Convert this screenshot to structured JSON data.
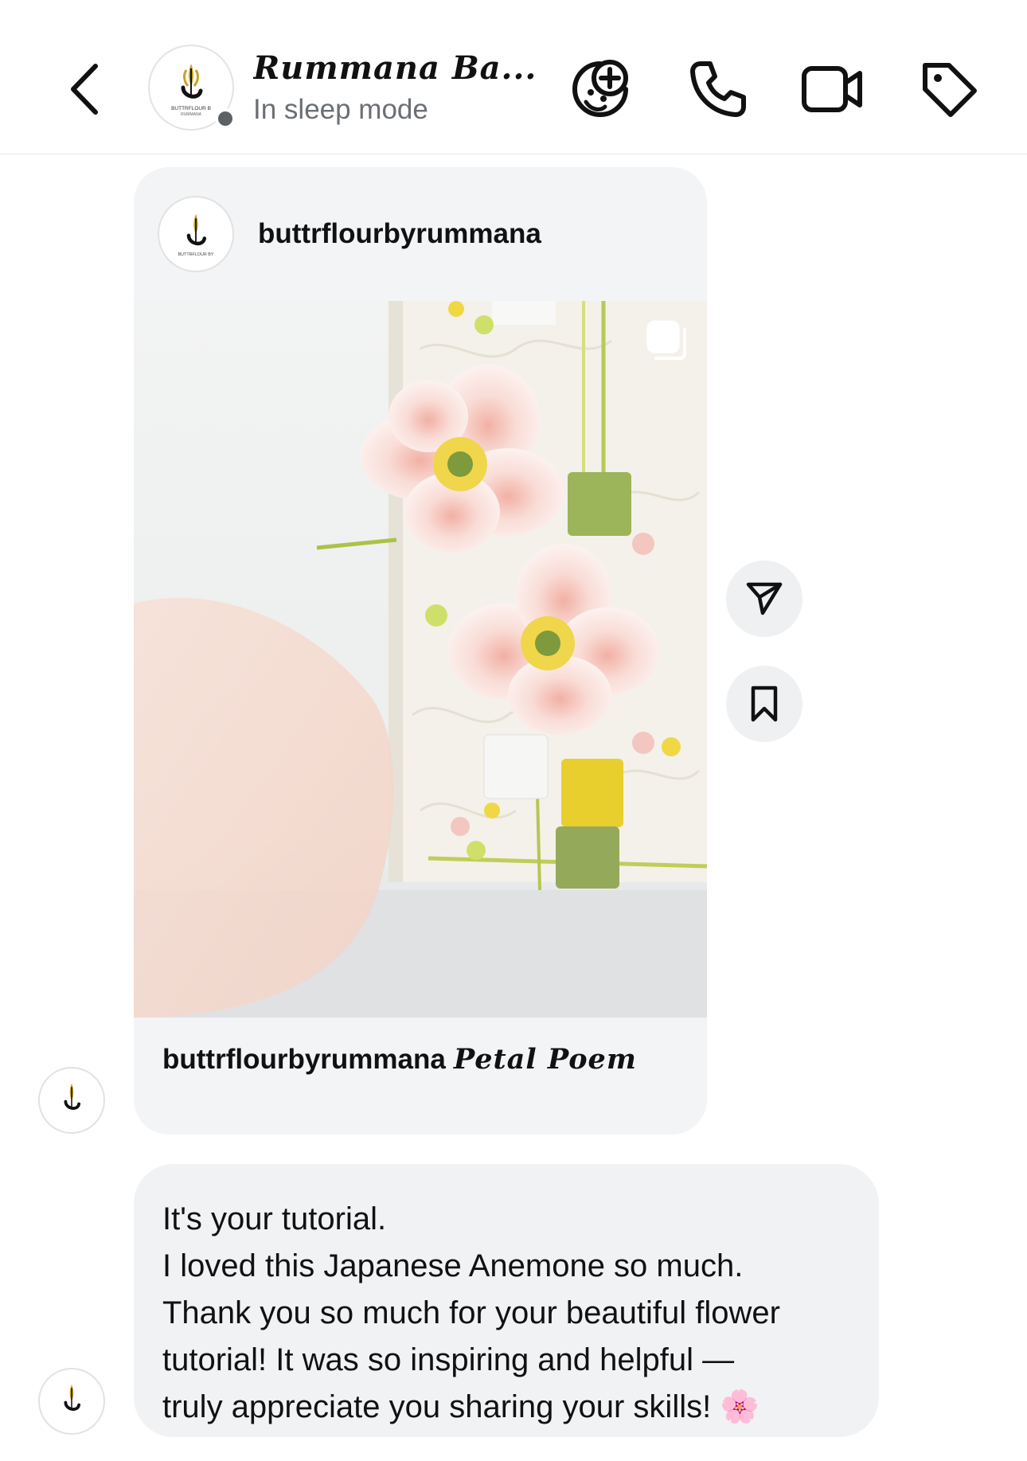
{
  "header": {
    "title": "Rummana Ba...",
    "status": "In sleep mode",
    "avatar_brand_top": "BUTTRFLOUR B",
    "avatar_brand_bottom": "RUMMANA",
    "icons": [
      "back-icon",
      "sticker-add-icon",
      "phone-icon",
      "video-camera-icon",
      "tag-icon"
    ]
  },
  "post": {
    "username": "buttrflourbyrummana",
    "caption_user": "buttrflourbyrummana",
    "caption_text": "Petal Poem",
    "avatar_brand": "BUTTRFLOUR BY",
    "image_description_icon": "carousel-icon"
  },
  "side_actions": [
    "send-icon",
    "bookmark-icon"
  ],
  "message": {
    "lines": [
      "It's your tutorial.",
      "I loved this Japanese Anemone so much.",
      "Thank you so much for your beautiful flower",
      "tutorial! It was so inspiring and helpful —",
      "truly appreciate you sharing your skills! 🌸"
    ]
  },
  "colors": {
    "bubble": "#f1f2f4",
    "card": "#f3f4f6",
    "status_text": "#6b6f74",
    "divider": "#e8e8e8"
  }
}
